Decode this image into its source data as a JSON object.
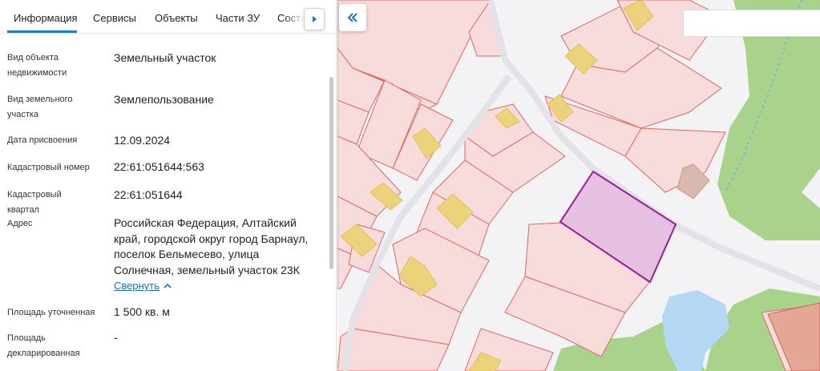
{
  "tabs": [
    {
      "label": "Информация",
      "active": true
    },
    {
      "label": "Сервисы",
      "active": false
    },
    {
      "label": "Объекты",
      "active": false
    },
    {
      "label": "Части ЗУ",
      "active": false
    },
    {
      "label": "Состав",
      "active": false
    }
  ],
  "fields": [
    {
      "label": "Вид объекта недвижимости",
      "value": "Земельный участок"
    },
    {
      "label": "Вид земельного участка",
      "value": "Землепользование"
    },
    {
      "label": "Дата присвоения",
      "value": "12.09.2024"
    },
    {
      "label": "Кадастровый номер",
      "value": "22:61:051644:563"
    },
    {
      "label": "Кадастровый квартал",
      "value": "22:61:051644"
    },
    {
      "label": "Адрес",
      "value": "Российская Федерация, Алтайский край, городской округ город Барнаул, поселок Бельмесево, улица Солнечная, земельный участок 23К"
    },
    {
      "label": "Площадь уточненная",
      "value": "1 500 кв. м"
    },
    {
      "label": "Площадь декларированная",
      "value": "-"
    }
  ],
  "address_toggle": "Свернуть",
  "map_search": {
    "value": "",
    "placeholder": ""
  },
  "colors": {
    "accent": "#1b7ad3",
    "parcel_fill": "#f8dcdc",
    "parcel_stroke": "#e06565",
    "building_fill": "#ecd27a",
    "selected_fill": "#e3b6dd",
    "selected_stroke": "#9b1d92",
    "forest": "#a9d38a",
    "water": "#b4d7f3",
    "road": "#f3f3f6"
  }
}
